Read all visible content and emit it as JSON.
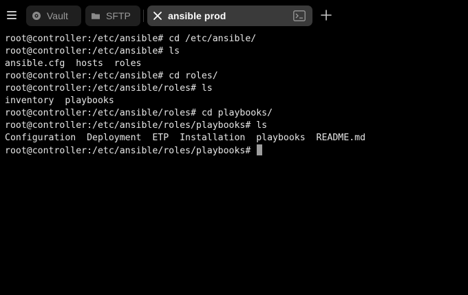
{
  "tabbar": {
    "menu_icon": "hamburger-menu-icon",
    "tabs": [
      {
        "label": "Vault",
        "icon": "vault-icon",
        "active": false
      },
      {
        "label": "SFTP",
        "icon": "folder-icon",
        "active": false
      },
      {
        "label": "ansible prod",
        "icon": "close-icon",
        "trailing_icon": "terminal-icon",
        "active": true
      }
    ],
    "new_tab_icon": "plus-icon"
  },
  "colors": {
    "background": "#000000",
    "tab_inactive": "#1f1f1f",
    "tab_active": "#3a3a3a",
    "text": "#e6e6e6",
    "cursor": "#9d9d9d"
  },
  "terminal": {
    "lines": [
      "root@controller:/etc/ansible# cd /etc/ansible/",
      "root@controller:/etc/ansible# ls",
      "ansible.cfg  hosts  roles",
      "root@controller:/etc/ansible# cd roles/",
      "root@controller:/etc/ansible/roles# ls",
      "inventory  playbooks",
      "root@controller:/etc/ansible/roles# cd playbooks/",
      "root@controller:/etc/ansible/roles/playbooks# ls",
      "Configuration  Deployment  ETP  Installation  playbooks  README.md"
    ],
    "prompt": "root@controller:/etc/ansible/roles/playbooks# "
  }
}
